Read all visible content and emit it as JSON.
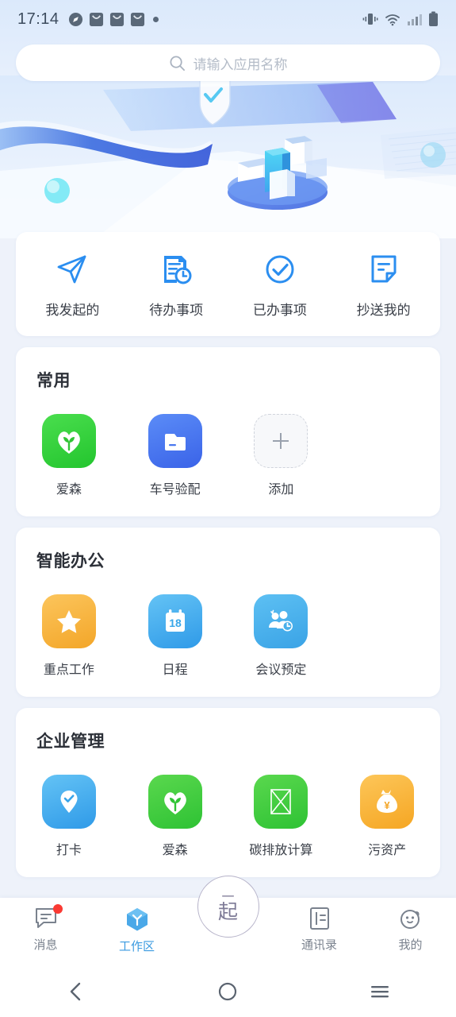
{
  "status_bar": {
    "time": "17:14",
    "left_icons": [
      "compass-icon",
      "mail-icon",
      "mail-icon",
      "mail-icon",
      "dot-icon"
    ],
    "right_icons": [
      "vibrate-icon",
      "wifi-icon",
      "signal-icon",
      "battery-icon"
    ]
  },
  "search": {
    "placeholder": "请输入应用名称",
    "icon": "search-icon"
  },
  "quick_actions": [
    {
      "label": "我发起的",
      "icon": "paper-plane-icon"
    },
    {
      "label": "待办事项",
      "icon": "document-clock-icon"
    },
    {
      "label": "已办事项",
      "icon": "check-circle-icon"
    },
    {
      "label": "抄送我的",
      "icon": "document-corner-icon"
    }
  ],
  "sections": [
    {
      "title": "常用",
      "apps": [
        {
          "label": "爱森",
          "icon": "heart-sprout-icon",
          "color": "#2ec234"
        },
        {
          "label": "车号验配",
          "icon": "folder-doc-icon",
          "color": "#3a63e8"
        },
        {
          "label": "添加",
          "icon": "plus-icon",
          "color": "#d0d4dc"
        }
      ]
    },
    {
      "title": "智能办公",
      "apps": [
        {
          "label": "重点工作",
          "icon": "star-icon",
          "color": "#f5a623"
        },
        {
          "label": "日程",
          "icon": "calendar-icon",
          "color": "#2f9ae8",
          "badge": "18"
        },
        {
          "label": "会议预定",
          "icon": "people-clock-icon",
          "color": "#3aa3e6"
        }
      ]
    },
    {
      "title": "企业管理",
      "apps": [
        {
          "label": "打卡",
          "icon": "location-check-icon",
          "color": "#2f9ae8"
        },
        {
          "label": "爱森",
          "icon": "heart-sprout-icon",
          "color": "#2ec234"
        },
        {
          "label": "碳排放计算",
          "icon": "broken-image-icon",
          "color": "#2ec234"
        },
        {
          "label": "污资产",
          "icon": "money-bag-icon",
          "color": "#f3a629"
        }
      ]
    }
  ],
  "bottom_nav": {
    "items": [
      {
        "label": "消息",
        "icon": "chat-icon",
        "active": false,
        "badge": true
      },
      {
        "label": "工作区",
        "icon": "hexagon-icon",
        "active": true,
        "badge": false
      },
      {
        "label": "通讯录",
        "icon": "contacts-icon",
        "active": false,
        "badge": false
      },
      {
        "label": "我的",
        "icon": "profile-icon",
        "active": false,
        "badge": false
      }
    ],
    "fab": {
      "line1": "一",
      "line2": "起",
      "icon": "fab-together-icon"
    },
    "active_color": "#3a9ae0"
  },
  "android_nav": {
    "back": "back-icon",
    "home": "home-icon",
    "recents": "recents-icon"
  }
}
